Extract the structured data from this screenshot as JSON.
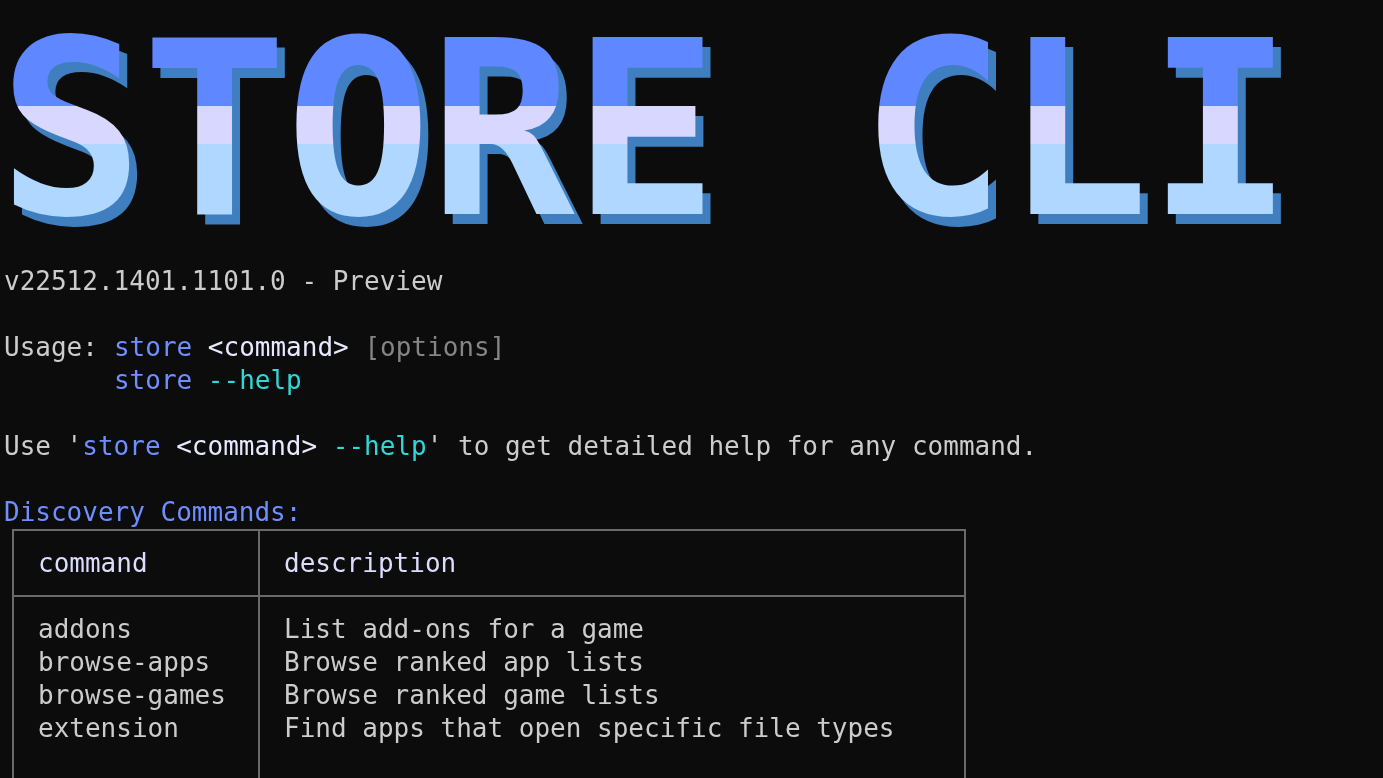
{
  "banner": {
    "text": "STORE CLI"
  },
  "version": "v22512.1401.1101.0 - Preview",
  "usage": {
    "label": "Usage:",
    "lines": [
      [
        {
          "kind": "command",
          "text": "store"
        },
        {
          "kind": "arg",
          "text": " <command>"
        },
        {
          "kind": "option",
          "text": " [options]"
        }
      ],
      [
        {
          "kind": "command",
          "text": "store"
        },
        {
          "kind": "flag",
          "text": " --help"
        }
      ]
    ]
  },
  "help_hint": [
    {
      "kind": "plain",
      "text": "Use '"
    },
    {
      "kind": "command",
      "text": "store"
    },
    {
      "kind": "arg",
      "text": " <command> "
    },
    {
      "kind": "flag",
      "text": "--help"
    },
    {
      "kind": "plain",
      "text": "' to get detailed help for any command."
    }
  ],
  "section_title": "Discovery Commands:",
  "table": {
    "columns": [
      "command",
      "description"
    ],
    "rows": [
      {
        "command": "addons",
        "description": "List add-ons for a game"
      },
      {
        "command": "browse-apps",
        "description": "Browse ranked app lists"
      },
      {
        "command": "browse-games",
        "description": "Browse ranked game lists"
      },
      {
        "command": "extension",
        "description": "Find apps that open specific file types"
      }
    ]
  }
}
